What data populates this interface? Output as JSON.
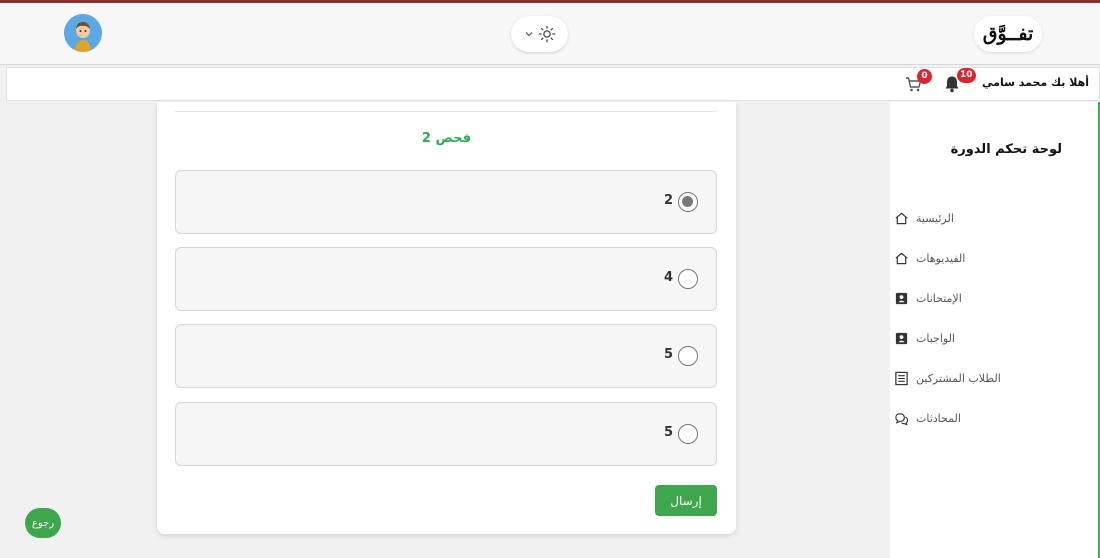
{
  "header": {
    "logo_text": "تفــوَّق",
    "avatar_icon": "student-avatar-icon",
    "theme_toggle_icon": "sun-icon"
  },
  "userbar": {
    "greeting": "أهلا بك محمد سامي",
    "notifications_count": "10",
    "cart_count": "0"
  },
  "sidebar": {
    "title": "لوحة تحكم الدورة",
    "items": [
      {
        "label": "الرئيسية",
        "icon": "home-icon"
      },
      {
        "label": "الفيديوهات",
        "icon": "home-icon"
      },
      {
        "label": "الإمتحانات",
        "icon": "contact-card-icon"
      },
      {
        "label": "الواجبات",
        "icon": "contact-card-icon"
      },
      {
        "label": "الطلاب المشتركين",
        "icon": "list-icon"
      },
      {
        "label": "المحادثات",
        "icon": "chat-icon"
      }
    ]
  },
  "quiz": {
    "title": "فحص 2",
    "options": [
      {
        "label": "2",
        "selected": true
      },
      {
        "label": "4",
        "selected": false
      },
      {
        "label": "5",
        "selected": false
      },
      {
        "label": "5",
        "selected": false
      }
    ],
    "submit_label": "إرسال"
  },
  "back_label": "رجوع",
  "colors": {
    "accent": "#3ea74e",
    "badge": "#d9262f",
    "top_line": "#8a2e2e"
  }
}
